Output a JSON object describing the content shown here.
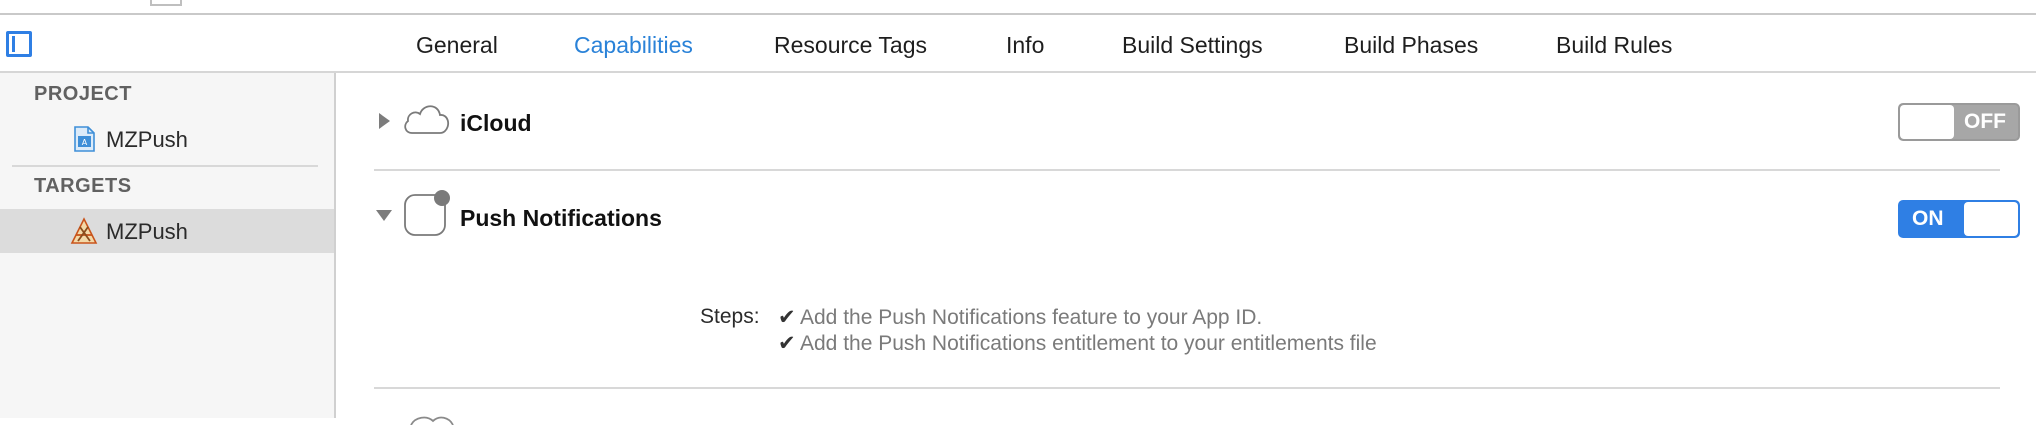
{
  "tabs": [
    {
      "label": "General",
      "active": false
    },
    {
      "label": "Capabilities",
      "active": true
    },
    {
      "label": "Resource Tags",
      "active": false
    },
    {
      "label": "Info",
      "active": false
    },
    {
      "label": "Build Settings",
      "active": false
    },
    {
      "label": "Build Phases",
      "active": false
    },
    {
      "label": "Build Rules",
      "active": false
    }
  ],
  "sidebar": {
    "project_header": "PROJECT",
    "project_item": "MZPush",
    "targets_header": "TARGETS",
    "target_item": "MZPush"
  },
  "capabilities": {
    "icloud": {
      "title": "iCloud",
      "toggle": "OFF",
      "expanded": false
    },
    "push": {
      "title": "Push Notifications",
      "toggle": "ON",
      "expanded": true,
      "steps_label": "Steps:",
      "steps": [
        "Add the Push Notifications feature to your App ID.",
        "Add the Push Notifications entitlement to your entitlements file"
      ]
    }
  },
  "colors": {
    "accent": "#2f7fe4",
    "tab_active": "#2a82d8",
    "toggle_off": "#a7a7a7",
    "selected_row": "#dcdcdc"
  },
  "icons": {
    "sidebar_toggle": "sidebar-toggle-icon",
    "project": "project-file-icon",
    "target": "app-target-icon",
    "icloud": "cloud-icon",
    "push": "push-notification-icon",
    "check": "checkmark-icon"
  }
}
